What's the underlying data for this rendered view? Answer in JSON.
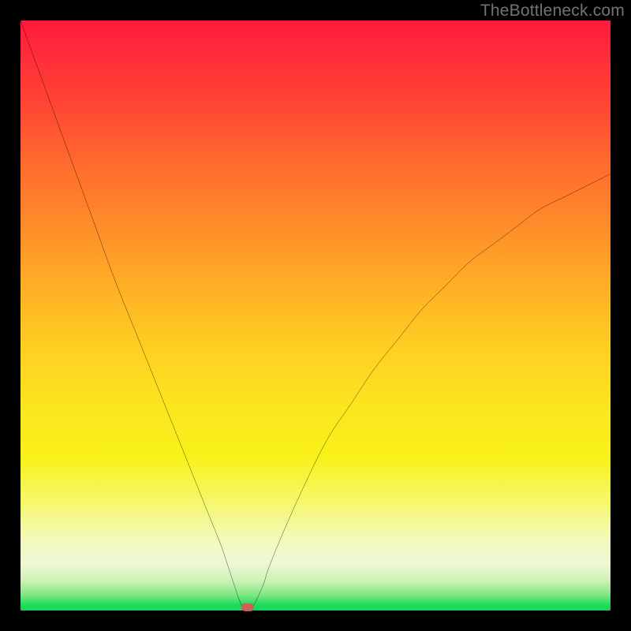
{
  "watermark": "TheBottleneck.com",
  "chart_data": {
    "type": "line",
    "title": "",
    "xlabel": "",
    "ylabel": "",
    "xlim": [
      0,
      100
    ],
    "ylim": [
      0,
      100
    ],
    "grid": false,
    "background": "red-yellow-green vertical gradient",
    "series": [
      {
        "name": "curve",
        "color": "#000000",
        "x": [
          0,
          4,
          8,
          12,
          16,
          20,
          24,
          28,
          30,
          32,
          34,
          35,
          36,
          37,
          38,
          39,
          41,
          42,
          44,
          48,
          52,
          56,
          60,
          64,
          68,
          72,
          76,
          80,
          84,
          88,
          92,
          96,
          100
        ],
        "y": [
          100,
          89,
          78,
          67,
          56,
          46,
          36,
          26,
          21,
          16,
          11,
          8,
          5,
          2,
          0,
          0,
          4,
          7,
          12,
          21,
          29,
          35,
          41,
          46,
          51,
          55,
          59,
          62,
          65,
          68,
          70,
          72,
          74
        ]
      }
    ],
    "marker": {
      "x": 38.5,
      "y": 0.5,
      "color": "#d25f57"
    }
  }
}
